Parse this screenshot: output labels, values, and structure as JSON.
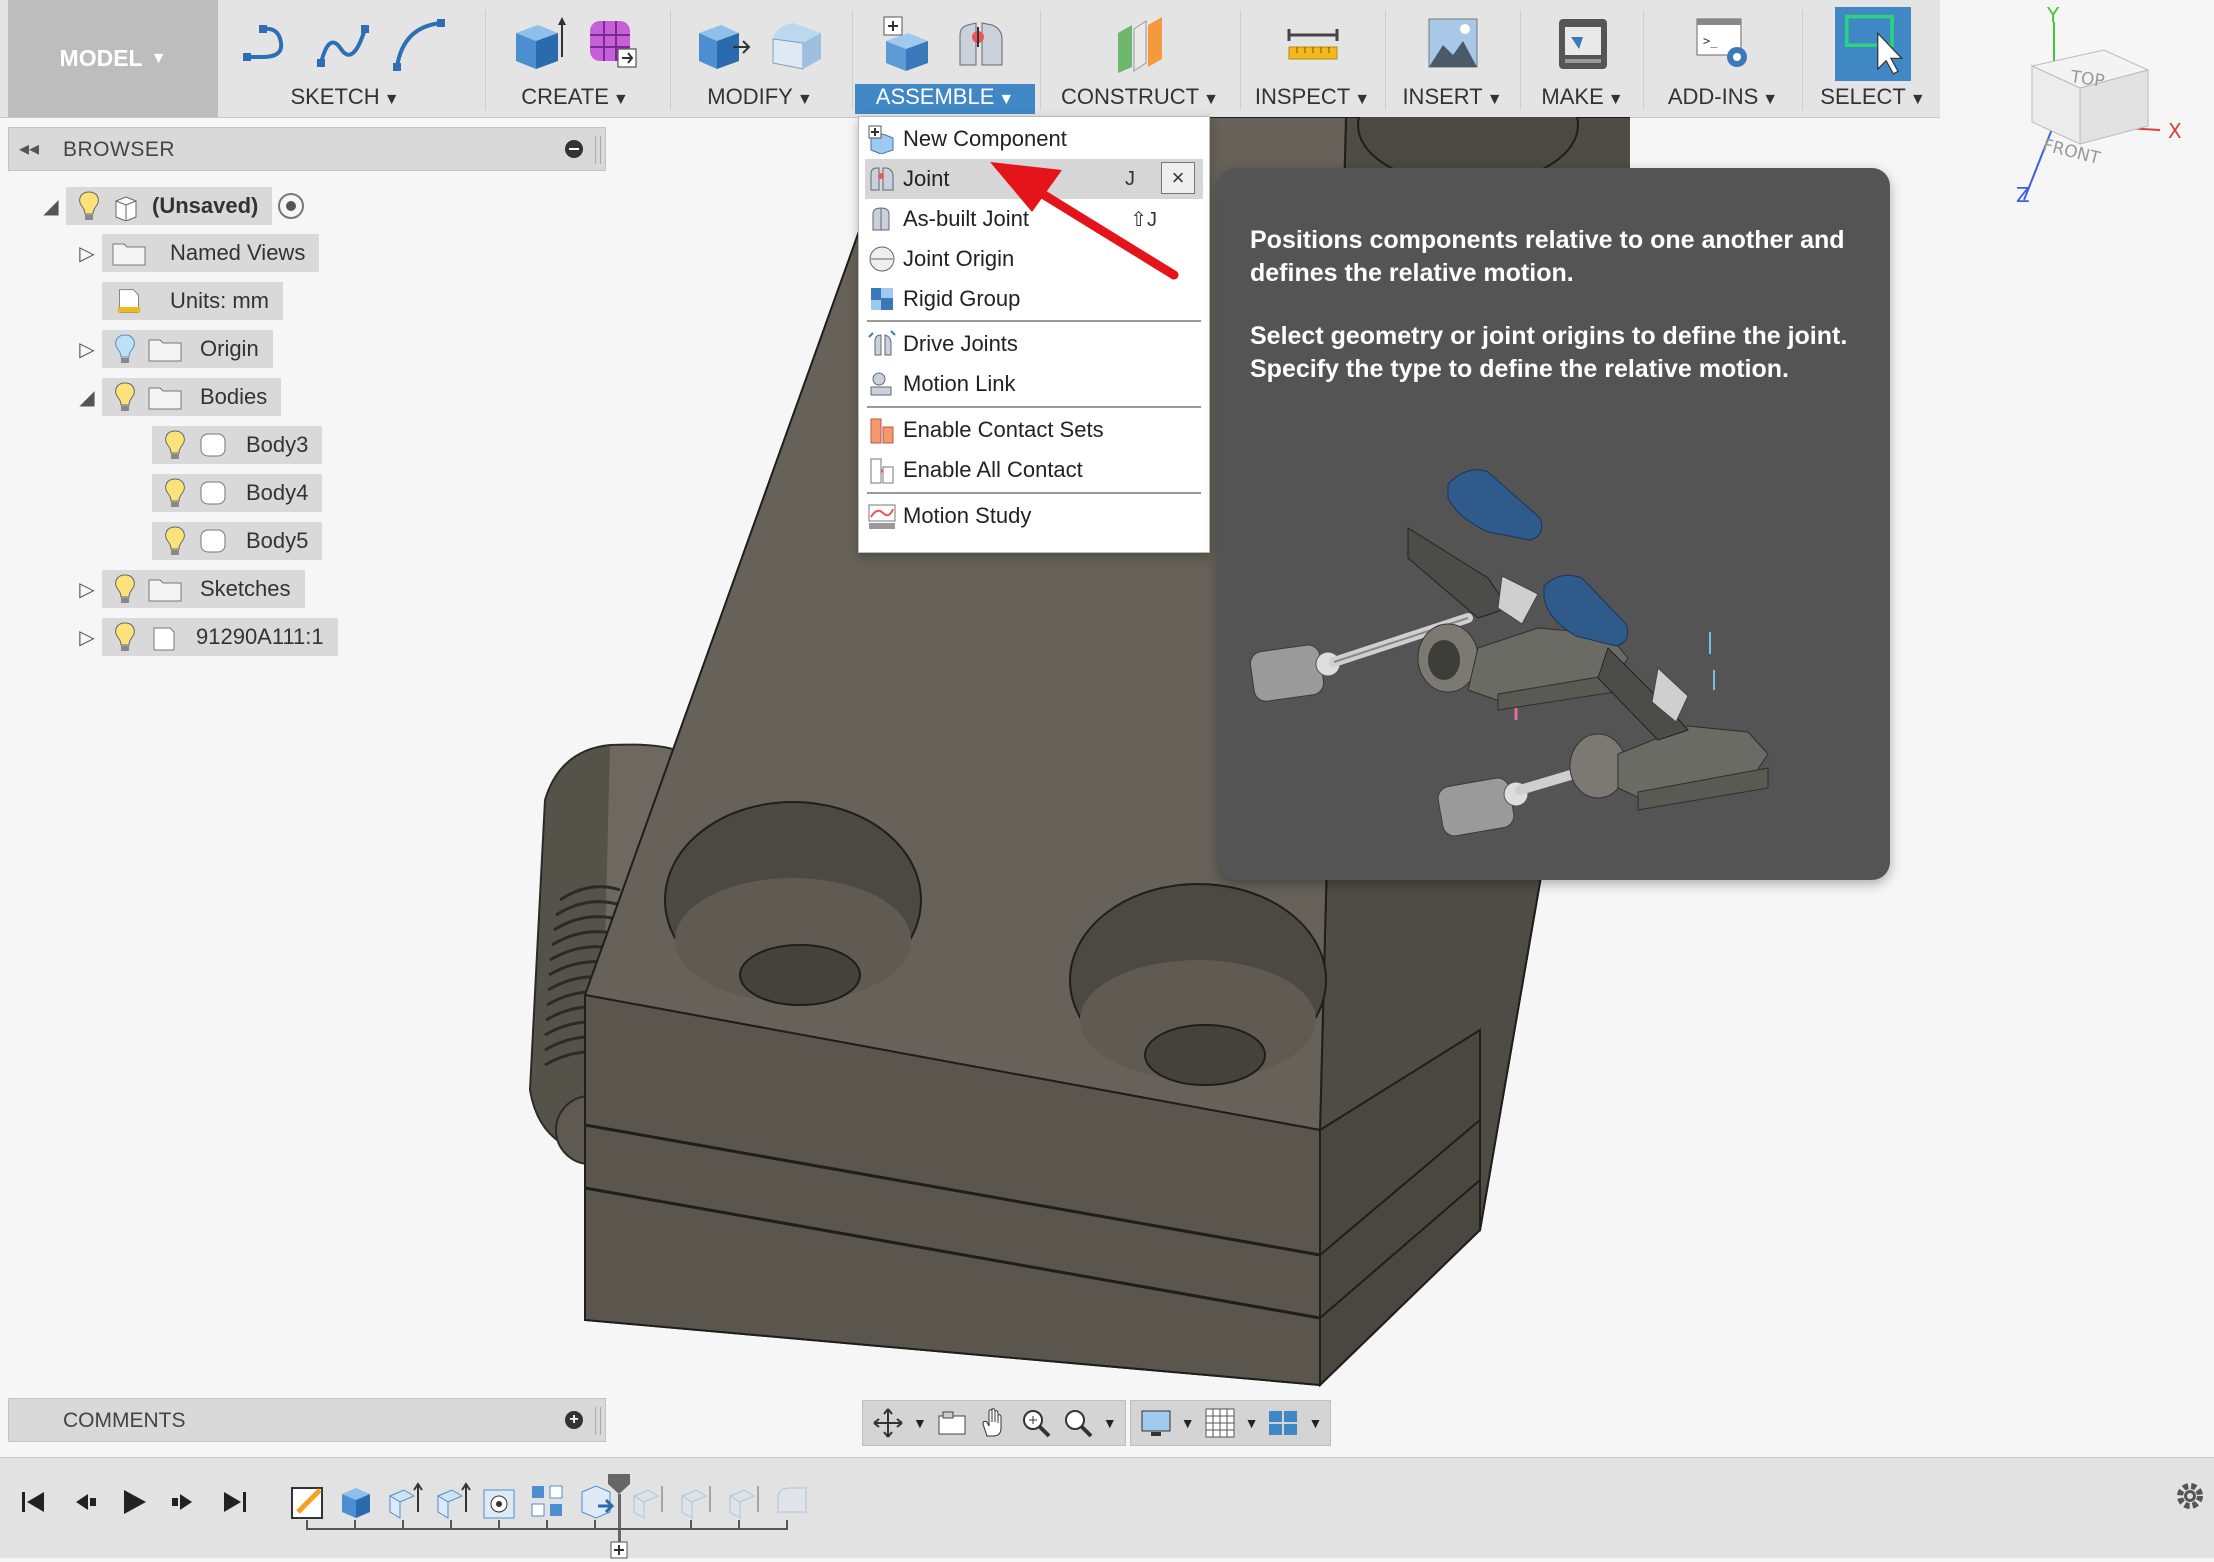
{
  "toolbar": {
    "workspace": "MODEL",
    "groups": [
      {
        "label": "SKETCH",
        "icons": [
          "line-sketch-icon",
          "spline-sketch-icon",
          "arc-sketch-icon"
        ]
      },
      {
        "label": "CREATE",
        "icons": [
          "extrude-icon",
          "form-icon"
        ]
      },
      {
        "label": "MODIFY",
        "icons": [
          "press-pull-icon",
          "fillet-icon"
        ]
      },
      {
        "label": "ASSEMBLE",
        "icons": [
          "new-component-icon",
          "joint-icon"
        ]
      },
      {
        "label": "CONSTRUCT",
        "icons": [
          "offset-plane-icon"
        ]
      },
      {
        "label": "INSPECT",
        "icons": [
          "measure-icon"
        ]
      },
      {
        "label": "INSERT",
        "icons": [
          "insert-image-icon"
        ]
      },
      {
        "label": "MAKE",
        "icons": [
          "3d-print-icon"
        ]
      },
      {
        "label": "ADD-INS",
        "icons": [
          "scripts-icon"
        ]
      },
      {
        "label": "SELECT",
        "icons": [
          "select-icon"
        ]
      }
    ]
  },
  "viewcube": {
    "top": "TOP",
    "front": "FRONT",
    "x": "X",
    "y": "Y",
    "z": "Z"
  },
  "browser": {
    "title": "BROWSER",
    "root": "(Unsaved)",
    "items": [
      {
        "label": "Named Views"
      },
      {
        "label": "Units: mm"
      },
      {
        "label": "Origin"
      },
      {
        "label": "Bodies"
      },
      {
        "label": "Body3"
      },
      {
        "label": "Body4"
      },
      {
        "label": "Body5"
      },
      {
        "label": "Sketches"
      },
      {
        "label": "91290A111:1"
      }
    ]
  },
  "assemble_menu": {
    "items": [
      {
        "label": "New Component"
      },
      {
        "label": "Joint",
        "shortcut": "J"
      },
      {
        "label": "As-built Joint",
        "shortcut": "⇧J"
      },
      {
        "label": "Joint Origin"
      },
      {
        "label": "Rigid Group"
      },
      {
        "label": "Drive Joints"
      },
      {
        "label": "Motion Link"
      },
      {
        "label": "Enable Contact Sets"
      },
      {
        "label": "Enable All Contact"
      },
      {
        "label": "Motion Study"
      }
    ],
    "close": "×"
  },
  "tooltip": {
    "line1": "Positions components relative to one another and defines the relative motion.",
    "line2": "Select geometry or joint origins to define the joint. Specify the type to define the relative motion."
  },
  "comments": {
    "title": "COMMENTS",
    "add": "+"
  },
  "colors": {
    "accent": "#3f87c5",
    "model": "#5b5850",
    "tooltip": "#545454",
    "arrow": "#e5141a"
  }
}
